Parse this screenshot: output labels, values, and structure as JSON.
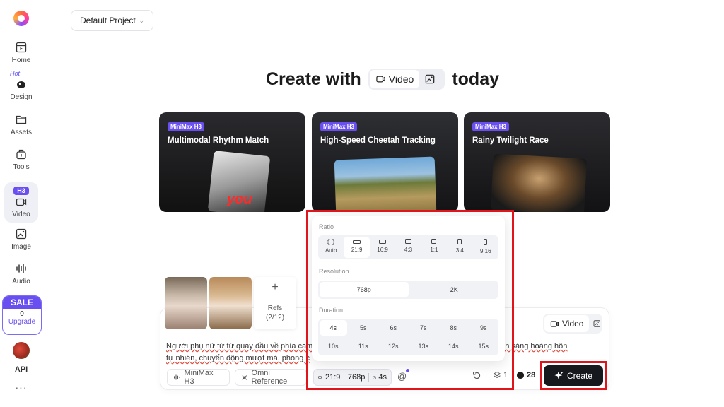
{
  "sidebar": {
    "hot_tag": "Hot",
    "h3_badge": "H3",
    "items": [
      {
        "label": "Home",
        "icon": "home-icon"
      },
      {
        "label": "Design",
        "icon": "design-icon"
      },
      {
        "label": "Assets",
        "icon": "folder-icon"
      },
      {
        "label": "Tools",
        "icon": "tools-icon"
      },
      {
        "label": "Video",
        "icon": "video-icon"
      },
      {
        "label": "Image",
        "icon": "image-icon"
      },
      {
        "label": "Audio",
        "icon": "audio-icon"
      }
    ],
    "sale": {
      "title": "SALE",
      "count": "0",
      "upgrade": "Upgrade"
    },
    "api_label": "API",
    "more": "···"
  },
  "project": {
    "name": "Default Project"
  },
  "headline": {
    "prefix": "Create with",
    "video": "Video",
    "suffix": "today"
  },
  "cards": [
    {
      "badge": "MiniMax H3",
      "title": "Multimodal Rhythm Match",
      "overlay": "you"
    },
    {
      "badge": "MiniMax H3",
      "title": "High-Speed Cheetah Tracking"
    },
    {
      "badge": "MiniMax H3",
      "title": "Rainy Twilight Race"
    }
  ],
  "popup": {
    "ratio_label": "Ratio",
    "ratios": [
      "Auto",
      "21:9",
      "16:9",
      "4:3",
      "1:1",
      "3:4",
      "9:16"
    ],
    "selected_ratio": "21:9",
    "resolution_label": "Resolution",
    "resolutions": [
      "768p",
      "2K"
    ],
    "selected_resolution": "768p",
    "duration_label": "Duration",
    "durations": [
      "4s",
      "5s",
      "6s",
      "7s",
      "8s",
      "9s",
      "10s",
      "11s",
      "12s",
      "13s",
      "14s",
      "15s"
    ],
    "selected_duration": "4s"
  },
  "composer": {
    "refs_label": "Refs",
    "refs_count": "(2/12)",
    "prompt_line1": "Người phụ nữ từ từ quay đầu về phía cam                                                                         ên tắn, ánh sáng hoàng hôn",
    "prompt_line2": "tự nhiên, chuyển động mượt mà, phong c",
    "mode": "Video",
    "model": "MiniMax H3",
    "omni": "Omni Reference",
    "settings": {
      "ratio": "21:9",
      "resolution": "768p",
      "duration": "4s"
    },
    "at": "@",
    "layers_count": "1",
    "credits": "28",
    "create_label": "Create"
  },
  "colors": {
    "accent": "#6a4ff0",
    "annotation": "#e0141b",
    "create_bg": "#16181d"
  }
}
